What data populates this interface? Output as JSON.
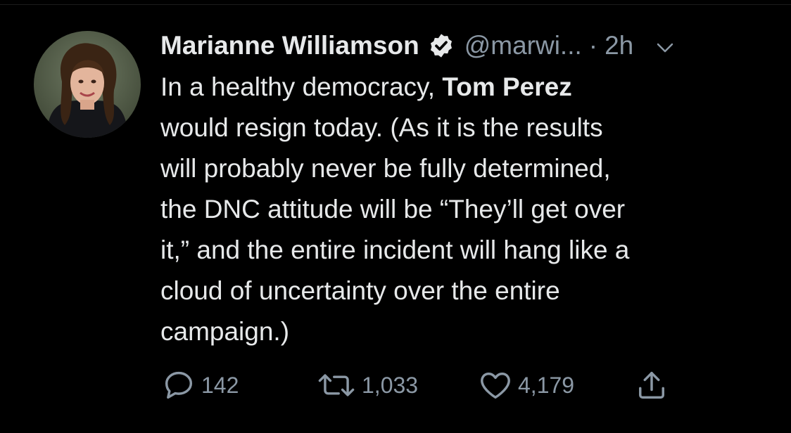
{
  "tweet": {
    "author_name": "Marianne Williamson",
    "handle": "@marwi...",
    "separator": "·",
    "time_ago": "2h",
    "lines": [
      {
        "pre": "In a healthy democracy, ",
        "bold": "Tom Perez",
        "post": ""
      },
      {
        "pre": "would resign today. (As it is the results",
        "bold": "",
        "post": ""
      },
      {
        "pre": "will probably never be fully determined,",
        "bold": "",
        "post": ""
      },
      {
        "pre": "the DNC attitude will be “They’ll get over",
        "bold": "",
        "post": ""
      },
      {
        "pre": "it,” and the entire incident will hang like a",
        "bold": "",
        "post": ""
      },
      {
        "pre": "cloud of uncertainty over the entire",
        "bold": "",
        "post": ""
      },
      {
        "pre": "campaign.)",
        "bold": "",
        "post": ""
      }
    ]
  },
  "actions": {
    "replies": "142",
    "retweets": "1,033",
    "likes": "4,179"
  },
  "icons": {
    "verified": "verified-badge-icon",
    "chevron": "chevron-down-icon",
    "reply": "reply-icon",
    "retweet": "retweet-icon",
    "like": "heart-icon",
    "share": "share-icon"
  },
  "colors": {
    "background": "#000000",
    "text": "#e7e9ea",
    "secondary": "#8b98a5"
  }
}
